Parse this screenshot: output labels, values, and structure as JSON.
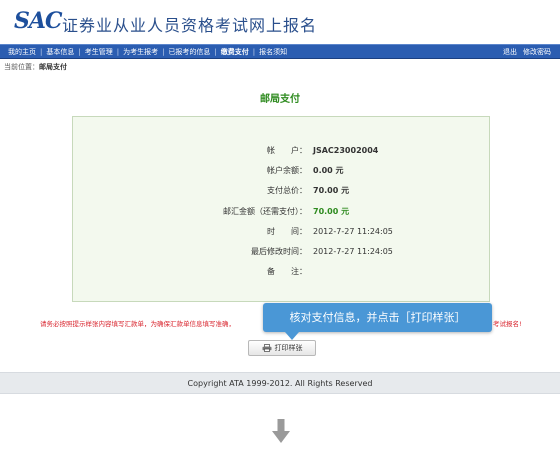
{
  "header": {
    "logo": "SAC",
    "title": "证券业从业人员资格考试网上报名"
  },
  "nav": {
    "items": [
      {
        "label": "我的主页"
      },
      {
        "label": "基本信息"
      },
      {
        "label": "考生管理"
      },
      {
        "label": "为考生报考"
      },
      {
        "label": "已报考的信息"
      },
      {
        "label": "缴费支付"
      },
      {
        "label": "报名须知"
      }
    ],
    "active_index": 5,
    "logout": "退出",
    "change_password": "修改密码"
  },
  "breadcrumb": {
    "prefix": "当前位置：",
    "current": "邮局支付"
  },
  "page_title": "邮局支付",
  "info": {
    "rows": [
      {
        "label": "帐　　户：",
        "value": "JSAC23002004",
        "style": "bold"
      },
      {
        "label": "帐户余额：",
        "value": "0.00 元",
        "style": "bold"
      },
      {
        "label": "支付总价：",
        "value": "70.00 元",
        "style": "bold"
      },
      {
        "label": "邮汇金额（还需支付）：",
        "value": "70.00 元",
        "style": "green"
      },
      {
        "label": "时　　间：",
        "value": "2012-7-27 11:24:05",
        "style": "normal"
      },
      {
        "label": "最后修改时间：",
        "value": "2012-7-27 11:24:05",
        "style": "normal"
      },
      {
        "label": "备　　注：",
        "value": "",
        "style": "normal"
      }
    ]
  },
  "notice": {
    "left": "请务必按照提示样张内容填写汇款单，为确保汇款单信息填写准确，",
    "right": "考试报名!"
  },
  "tooltip": {
    "text": "核对支付信息，并点击［打印样张］"
  },
  "print_button": {
    "label": "打印样张",
    "icon": "printer-icon"
  },
  "footer": {
    "copyright": "Copyright ATA 1999-2012. All Rights Reserved"
  },
  "colors": {
    "nav_bg": "#2b5db1",
    "title_green": "#2e8b1f",
    "notice_red": "#d9262f",
    "tooltip_blue": "#4a97d6",
    "box_bg": "#f3f9ee"
  }
}
